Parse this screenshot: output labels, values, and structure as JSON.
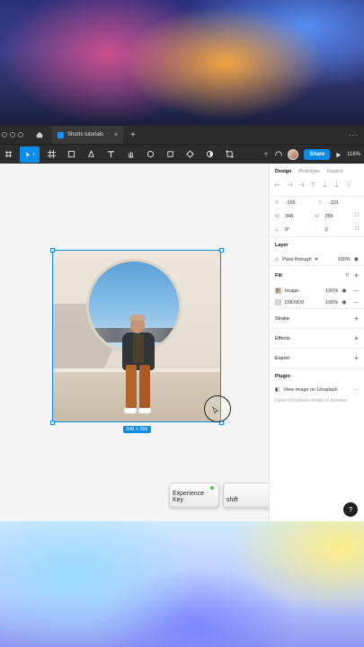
{
  "tabbar": {
    "tab_title": "Shorts tutorials",
    "close": "×",
    "add": "+",
    "more": "···"
  },
  "toolbar": {
    "share_label": "Share",
    "zoom": "116%"
  },
  "canvas": {
    "size_tag": "348 × 356"
  },
  "keys": {
    "key1": "Experience Key",
    "key2": "shift"
  },
  "panel": {
    "tabs": [
      "Design",
      "Prototype",
      "Inspect"
    ],
    "x_label": "X",
    "x_value": "-165",
    "y_label": "Y",
    "y_value": "-221",
    "w_label": "W",
    "w_value": "348",
    "h_label": "H",
    "h_value": "356",
    "rotation": "0°",
    "radius": "0",
    "layer_title": "Layer",
    "blend_mode": "Pass through",
    "layer_opacity": "100%",
    "fill_title": "Fill",
    "fills": [
      {
        "name": "Image",
        "opacity": "100%"
      },
      {
        "name": "D9D9D9",
        "opacity": "100%"
      }
    ],
    "stroke_title": "Stroke",
    "effects_title": "Effects",
    "export_title": "Export",
    "plugin_title": "Plugin",
    "plugin_name": "View image on Unsplash",
    "plugin_action": "Open Unsplash image in browser"
  },
  "help": "?"
}
